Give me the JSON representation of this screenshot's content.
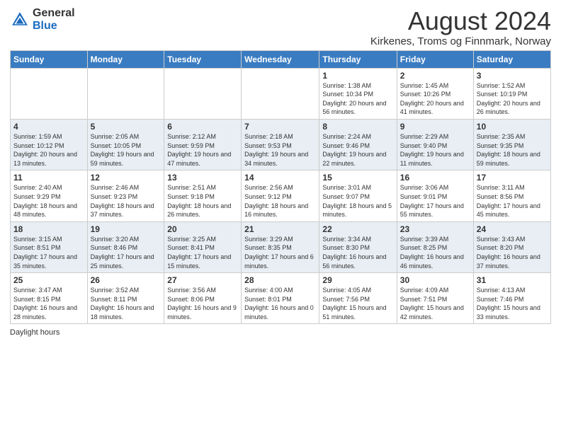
{
  "header": {
    "logo_general": "General",
    "logo_blue": "Blue",
    "month_title": "August 2024",
    "subtitle": "Kirkenes, Troms og Finnmark, Norway"
  },
  "weekdays": [
    "Sunday",
    "Monday",
    "Tuesday",
    "Wednesday",
    "Thursday",
    "Friday",
    "Saturday"
  ],
  "rows": [
    [
      {
        "day": "",
        "info": ""
      },
      {
        "day": "",
        "info": ""
      },
      {
        "day": "",
        "info": ""
      },
      {
        "day": "",
        "info": ""
      },
      {
        "day": "1",
        "info": "Sunrise: 1:38 AM\nSunset: 10:34 PM\nDaylight: 20 hours\nand 56 minutes."
      },
      {
        "day": "2",
        "info": "Sunrise: 1:45 AM\nSunset: 10:26 PM\nDaylight: 20 hours\nand 41 minutes."
      },
      {
        "day": "3",
        "info": "Sunrise: 1:52 AM\nSunset: 10:19 PM\nDaylight: 20 hours\nand 26 minutes."
      }
    ],
    [
      {
        "day": "4",
        "info": "Sunrise: 1:59 AM\nSunset: 10:12 PM\nDaylight: 20 hours\nand 13 minutes."
      },
      {
        "day": "5",
        "info": "Sunrise: 2:05 AM\nSunset: 10:05 PM\nDaylight: 19 hours\nand 59 minutes."
      },
      {
        "day": "6",
        "info": "Sunrise: 2:12 AM\nSunset: 9:59 PM\nDaylight: 19 hours\nand 47 minutes."
      },
      {
        "day": "7",
        "info": "Sunrise: 2:18 AM\nSunset: 9:53 PM\nDaylight: 19 hours\nand 34 minutes."
      },
      {
        "day": "8",
        "info": "Sunrise: 2:24 AM\nSunset: 9:46 PM\nDaylight: 19 hours\nand 22 minutes."
      },
      {
        "day": "9",
        "info": "Sunrise: 2:29 AM\nSunset: 9:40 PM\nDaylight: 19 hours\nand 11 minutes."
      },
      {
        "day": "10",
        "info": "Sunrise: 2:35 AM\nSunset: 9:35 PM\nDaylight: 18 hours\nand 59 minutes."
      }
    ],
    [
      {
        "day": "11",
        "info": "Sunrise: 2:40 AM\nSunset: 9:29 PM\nDaylight: 18 hours\nand 48 minutes."
      },
      {
        "day": "12",
        "info": "Sunrise: 2:46 AM\nSunset: 9:23 PM\nDaylight: 18 hours\nand 37 minutes."
      },
      {
        "day": "13",
        "info": "Sunrise: 2:51 AM\nSunset: 9:18 PM\nDaylight: 18 hours\nand 26 minutes."
      },
      {
        "day": "14",
        "info": "Sunrise: 2:56 AM\nSunset: 9:12 PM\nDaylight: 18 hours\nand 16 minutes."
      },
      {
        "day": "15",
        "info": "Sunrise: 3:01 AM\nSunset: 9:07 PM\nDaylight: 18 hours\nand 5 minutes."
      },
      {
        "day": "16",
        "info": "Sunrise: 3:06 AM\nSunset: 9:01 PM\nDaylight: 17 hours\nand 55 minutes."
      },
      {
        "day": "17",
        "info": "Sunrise: 3:11 AM\nSunset: 8:56 PM\nDaylight: 17 hours\nand 45 minutes."
      }
    ],
    [
      {
        "day": "18",
        "info": "Sunrise: 3:15 AM\nSunset: 8:51 PM\nDaylight: 17 hours\nand 35 minutes."
      },
      {
        "day": "19",
        "info": "Sunrise: 3:20 AM\nSunset: 8:46 PM\nDaylight: 17 hours\nand 25 minutes."
      },
      {
        "day": "20",
        "info": "Sunrise: 3:25 AM\nSunset: 8:41 PM\nDaylight: 17 hours\nand 15 minutes."
      },
      {
        "day": "21",
        "info": "Sunrise: 3:29 AM\nSunset: 8:35 PM\nDaylight: 17 hours\nand 6 minutes."
      },
      {
        "day": "22",
        "info": "Sunrise: 3:34 AM\nSunset: 8:30 PM\nDaylight: 16 hours\nand 56 minutes."
      },
      {
        "day": "23",
        "info": "Sunrise: 3:39 AM\nSunset: 8:25 PM\nDaylight: 16 hours\nand 46 minutes."
      },
      {
        "day": "24",
        "info": "Sunrise: 3:43 AM\nSunset: 8:20 PM\nDaylight: 16 hours\nand 37 minutes."
      }
    ],
    [
      {
        "day": "25",
        "info": "Sunrise: 3:47 AM\nSunset: 8:15 PM\nDaylight: 16 hours\nand 28 minutes."
      },
      {
        "day": "26",
        "info": "Sunrise: 3:52 AM\nSunset: 8:11 PM\nDaylight: 16 hours\nand 18 minutes."
      },
      {
        "day": "27",
        "info": "Sunrise: 3:56 AM\nSunset: 8:06 PM\nDaylight: 16 hours\nand 9 minutes."
      },
      {
        "day": "28",
        "info": "Sunrise: 4:00 AM\nSunset: 8:01 PM\nDaylight: 16 hours\nand 0 minutes."
      },
      {
        "day": "29",
        "info": "Sunrise: 4:05 AM\nSunset: 7:56 PM\nDaylight: 15 hours\nand 51 minutes."
      },
      {
        "day": "30",
        "info": "Sunrise: 4:09 AM\nSunset: 7:51 PM\nDaylight: 15 hours\nand 42 minutes."
      },
      {
        "day": "31",
        "info": "Sunrise: 4:13 AM\nSunset: 7:46 PM\nDaylight: 15 hours\nand 33 minutes."
      }
    ]
  ],
  "footer": {
    "daylight_label": "Daylight hours"
  }
}
